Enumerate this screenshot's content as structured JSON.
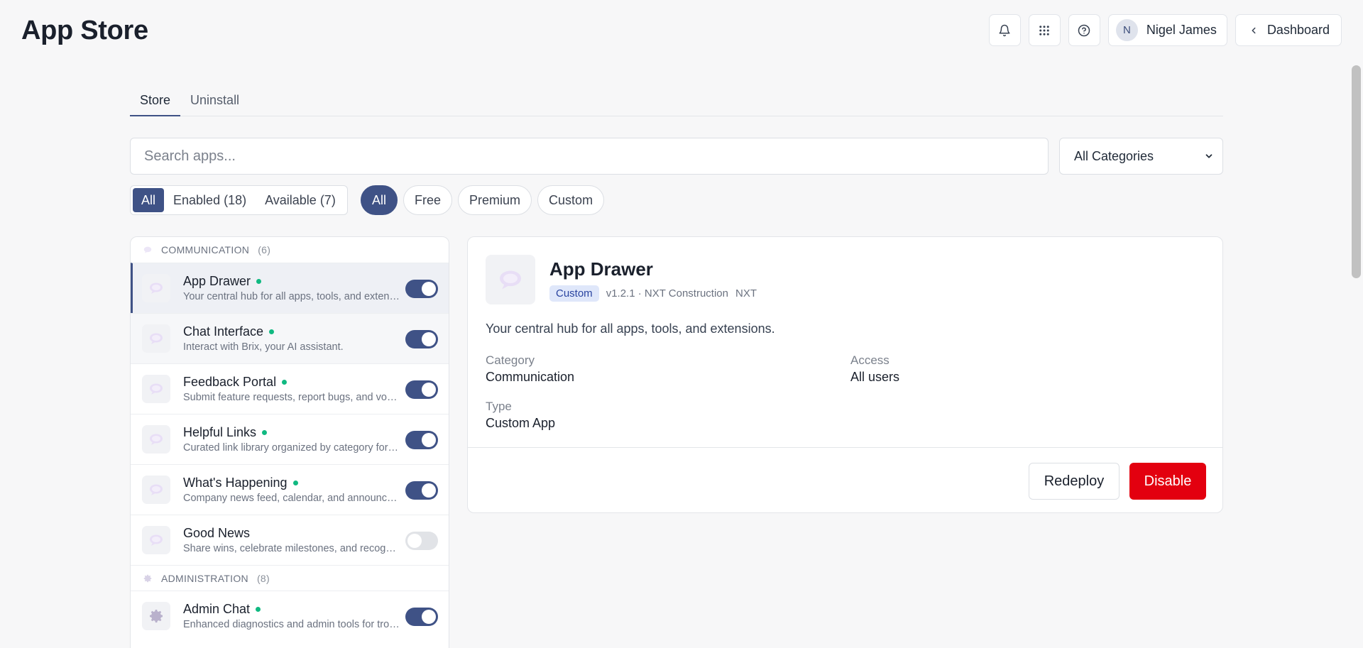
{
  "header": {
    "title": "App Store",
    "user_initial": "N",
    "user_name": "Nigel James",
    "dashboard_label": "Dashboard"
  },
  "tabs": [
    {
      "label": "Store",
      "active": true
    },
    {
      "label": "Uninstall",
      "active": false
    }
  ],
  "search": {
    "placeholder": "Search apps...",
    "value": ""
  },
  "category_select": {
    "selected": "All Categories"
  },
  "status_filter": [
    {
      "label": "All",
      "active": true
    },
    {
      "label": "Enabled (18)",
      "active": false
    },
    {
      "label": "Available (7)",
      "active": false
    }
  ],
  "type_filter": [
    {
      "label": "All",
      "active": true
    },
    {
      "label": "Free",
      "active": false
    },
    {
      "label": "Premium",
      "active": false
    },
    {
      "label": "Custom",
      "active": false
    }
  ],
  "groups": [
    {
      "name": "COMMUNICATION",
      "count": "(6)",
      "icon": "speech-bubble-icon",
      "apps": [
        {
          "name": "App Drawer",
          "desc": "Your central hub for all apps, tools, and extensions.",
          "enabled": true,
          "active_dot": true
        },
        {
          "name": "Chat Interface",
          "desc": "Interact with Brix, your AI assistant.",
          "enabled": true,
          "active_dot": true
        },
        {
          "name": "Feedback Portal",
          "desc": "Submit feature requests, report bugs, and vote on ideas.",
          "enabled": true,
          "active_dot": true
        },
        {
          "name": "Helpful Links",
          "desc": "Curated link library organized by category for quick access.",
          "enabled": true,
          "active_dot": true
        },
        {
          "name": "What's Happening",
          "desc": "Company news feed, calendar, and announcements.",
          "enabled": true,
          "active_dot": true
        },
        {
          "name": "Good News",
          "desc": "Share wins, celebrate milestones, and recognize teammates.",
          "enabled": false,
          "active_dot": false
        }
      ]
    },
    {
      "name": "ADMINISTRATION",
      "count": "(8)",
      "icon": "gear-icon",
      "apps": [
        {
          "name": "Admin Chat",
          "desc": "Enhanced diagnostics and admin tools for troubleshooting.",
          "enabled": true,
          "active_dot": true
        }
      ]
    }
  ],
  "detail": {
    "name": "App Drawer",
    "badge": "Custom",
    "version_line": "v1.2.1 · NXT Construction",
    "vendor_code": "NXT",
    "description": "Your central hub for all apps, tools, and extensions.",
    "category_label": "Category",
    "category_value": "Communication",
    "access_label": "Access",
    "access_value": "All users",
    "type_label": "Type",
    "type_value": "Custom App",
    "redeploy_label": "Redeploy",
    "disable_label": "Disable"
  },
  "colors": {
    "primary": "#3f5286",
    "danger": "#e3000f",
    "status_dot": "#10b981",
    "badge_bg": "#dfe7fa"
  }
}
